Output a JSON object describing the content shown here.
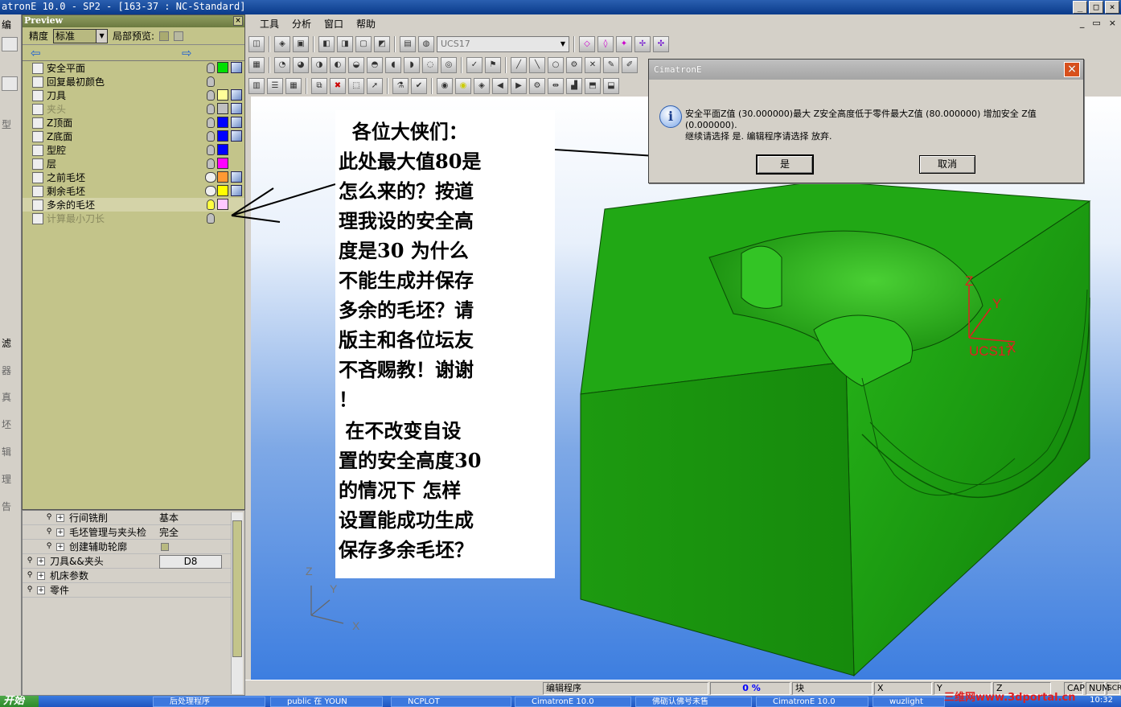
{
  "window": {
    "title": "atronE 10.0 - SP2 - [163-37 : NC-Standard]",
    "buttons": [
      "_",
      "□",
      "×"
    ]
  },
  "left_strip": {
    "top_label": "编",
    "labels": [
      "型",
      "滤",
      "器",
      "真",
      "坯",
      "辑",
      "理",
      "告"
    ]
  },
  "preview": {
    "title": "Preview",
    "close": "×",
    "precision_label": "精度",
    "precision_value": "标准",
    "local_preview_label": "局部预览:",
    "layers": [
      {
        "name": "安全平面",
        "bulb": "off",
        "color": "#00e000",
        "cube": true,
        "enabled": true
      },
      {
        "name": "回复最初颜色",
        "bulb": "off",
        "color": null,
        "cube": false,
        "enabled": true
      },
      {
        "name": "刀具",
        "bulb": "off",
        "color": "#ffff99",
        "cube": true,
        "enabled": true
      },
      {
        "name": "夹头",
        "bulb": "off",
        "color": "#c0c0c0",
        "cube": true,
        "enabled": false
      },
      {
        "name": "Z顶面",
        "bulb": "off",
        "color": "#0000ff",
        "cube": true,
        "enabled": true
      },
      {
        "name": "Z底面",
        "bulb": "off",
        "color": "#0000ff",
        "cube": true,
        "enabled": true
      },
      {
        "name": "型腔",
        "bulb": "off",
        "color": "#0000ff",
        "cube": false,
        "enabled": true
      },
      {
        "name": "层",
        "bulb": "off",
        "color": "#ff00ff",
        "cube": false,
        "enabled": true
      },
      {
        "name": "之前毛坯",
        "bulb": "glasses",
        "color": "#ff9933",
        "cube": true,
        "enabled": true
      },
      {
        "name": "剩余毛坯",
        "bulb": "glasses",
        "color": "#ffff00",
        "cube": true,
        "enabled": true
      },
      {
        "name": "多余的毛坯",
        "bulb": "on",
        "color": "#ffc8ff",
        "cube": false,
        "enabled": true
      },
      {
        "name": "计算最小刀长",
        "bulb": "off",
        "color": null,
        "cube": false,
        "enabled": false
      }
    ]
  },
  "tree": {
    "rows": [
      {
        "label": "行间铣削",
        "value": "基本",
        "indent": 2
      },
      {
        "label": "毛坯管理与夹头检",
        "value": "完全",
        "indent": 2
      },
      {
        "label": "创建辅助轮廓",
        "value": "",
        "indent": 2,
        "checkbox": true
      },
      {
        "label": "刀具&&夹头",
        "value": "D8",
        "indent": 1,
        "value_button": true
      },
      {
        "label": "机床参数",
        "value": "",
        "indent": 1
      },
      {
        "label": "零件",
        "value": "",
        "indent": 1
      }
    ]
  },
  "menu": {
    "items": [
      "工具",
      "分析",
      "窗口",
      "帮助"
    ],
    "window_controls": [
      "_",
      "▭",
      "×"
    ]
  },
  "toolbar": {
    "ucs_value": "UCS17"
  },
  "note": {
    "para1": "  各位大侠们：\n此处最大值80是\n怎么来的？按道\n理我设的安全高\n度是30 为什么\n不能生成并保存\n多余的毛坯？请\n版主和各位坛友\n不吝赐教！谢谢\n！",
    "para2": " 在不改变自设\n置的安全高度30\n的情况下 怎样\n设置能成功生成\n保存多余毛坯？"
  },
  "dialog": {
    "title": "CimatronE",
    "close": "×",
    "message": "安全平面Z值 (30.000000)最大 Z安全高度低于零件最大Z值 (80.000000) 增加安全 Z值 (0.000000).\n继续请选择 是. 编辑程序请选择 放弃.",
    "icon": "i",
    "yes_label": "是",
    "cancel_label": "取消"
  },
  "viewport": {
    "axis_labels": {
      "z": "Z",
      "y": "Y",
      "x": "X"
    },
    "ucs_labels": {
      "z": "Z",
      "y": "Y",
      "x": "X",
      "name": "UCS17"
    }
  },
  "statusbar": {
    "mode": "编辑程序",
    "percent": "0 %",
    "unit": "块",
    "x_label": "X",
    "y_label": "Y",
    "z_label": "Z",
    "caps": "CAP",
    "num": "NUM",
    "scrl": "SCRL"
  },
  "taskbar": {
    "start": "开始",
    "items": [
      "后处理程序",
      "public 在 YOUN",
      "NCPLOT",
      "CimatronE 10.0",
      "佛砺认佛号未售",
      "CimatronE 10.0",
      "wuzlight"
    ],
    "clock": "10:32"
  },
  "watermark": "三维网www.3dportal.cn",
  "colors": {
    "model_green": "#1f9e12",
    "annotation_arrow": "#000000",
    "ucs_red": "#e02020"
  }
}
